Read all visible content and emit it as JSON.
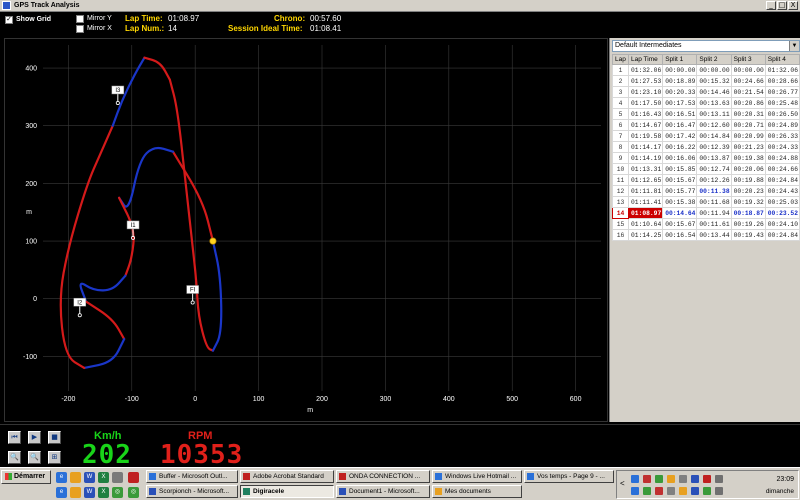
{
  "window": {
    "title": "GPS Track Analysis",
    "minimize": "_",
    "maximize": "□",
    "close": "X"
  },
  "header": {
    "show_grid_label": "Show Grid",
    "show_grid_checked": true,
    "mirror_y_label": "Mirror Y",
    "mirror_x_label": "Mirror X",
    "lap_time_label": "Lap Time:",
    "lap_time_value": "01:08.97",
    "lap_num_label": "Lap Num.:",
    "lap_num_value": "14",
    "chrono_label": "Chrono:",
    "chrono_value": "00:57.60",
    "session_ideal_label": "Session Ideal Time:",
    "session_ideal_value": "01:08.41"
  },
  "chart_data": {
    "type": "line",
    "xlabel": "m",
    "ylabel": "m",
    "xlim": [
      -240,
      640
    ],
    "ylim": [
      -160,
      440
    ],
    "grid": true,
    "x_ticks": [
      "-200",
      "-100",
      "0",
      "100",
      "200",
      "300",
      "400",
      "500",
      "600"
    ],
    "y_ticks": [
      "-100",
      "0",
      "100",
      "200",
      "300",
      "400"
    ],
    "markers": [
      {
        "label": "I3",
        "x": -122,
        "y": 362
      },
      {
        "label": "I1",
        "x": -98,
        "y": 128
      },
      {
        "label": "FI",
        "x": -4,
        "y": 16
      },
      {
        "label": "I2",
        "x": -182,
        "y": -6
      }
    ],
    "current_position": {
      "x": 28,
      "y": 100
    },
    "series": [
      {
        "color": "#d41a1a",
        "segment": 1,
        "points": [
          [
            -40,
            380
          ],
          [
            -28,
            330
          ],
          [
            -15,
            200
          ],
          [
            -5,
            100
          ],
          [
            2,
            30
          ],
          [
            5,
            -30
          ],
          [
            18,
            -85
          ],
          [
            28,
            -90
          ]
        ]
      },
      {
        "color": "#1a36c8",
        "segment": 2,
        "points": [
          [
            28,
            -90
          ],
          [
            42,
            -60
          ],
          [
            40,
            40
          ],
          [
            28,
            100
          ]
        ]
      },
      {
        "color": "#d41a1a",
        "segment": 3,
        "points": [
          [
            28,
            100
          ],
          [
            12,
            170
          ],
          [
            -35,
            255
          ]
        ]
      },
      {
        "color": "#1a36c8",
        "segment": 4,
        "points": [
          [
            -35,
            255
          ],
          [
            -65,
            265
          ],
          [
            -88,
            240
          ],
          [
            -105,
            150
          ],
          [
            -120,
            175
          ]
        ]
      },
      {
        "color": "#d41a1a",
        "segment": 5,
        "points": [
          [
            -120,
            175
          ],
          [
            -95,
            120
          ],
          [
            -100,
            70
          ],
          [
            -110,
            40
          ]
        ]
      },
      {
        "color": "#1a36c8",
        "segment": 6,
        "points": [
          [
            -110,
            40
          ],
          [
            -130,
            15
          ],
          [
            -160,
            14
          ],
          [
            -185,
            32
          ],
          [
            -172,
            -5
          ]
        ]
      },
      {
        "color": "#d41a1a",
        "segment": 7,
        "points": [
          [
            -172,
            -5
          ],
          [
            -130,
            -35
          ],
          [
            -112,
            -70
          ]
        ]
      },
      {
        "color": "#1a36c8",
        "segment": 8,
        "points": [
          [
            -112,
            -70
          ],
          [
            -130,
            -110
          ],
          [
            -175,
            -120
          ]
        ]
      },
      {
        "color": "#d41a1a",
        "segment": 9,
        "points": [
          [
            -175,
            -120
          ],
          [
            -205,
            -100
          ],
          [
            -215,
            0
          ],
          [
            -200,
            90
          ],
          [
            -170,
            200
          ],
          [
            -150,
            250
          ],
          [
            -130,
            300
          ]
        ]
      },
      {
        "color": "#1a36c8",
        "segment": 10,
        "points": [
          [
            -130,
            300
          ],
          [
            -115,
            345
          ],
          [
            -95,
            390
          ],
          [
            -80,
            418
          ]
        ]
      },
      {
        "color": "#d41a1a",
        "segment": 11,
        "points": [
          [
            -80,
            418
          ],
          [
            -55,
            410
          ],
          [
            -40,
            380
          ]
        ]
      }
    ]
  },
  "laps_panel": {
    "dropdown_value": "Default Intermediates",
    "dropdown_arrow": "▼",
    "columns": [
      "Lap",
      "Lap Time",
      "Split 1",
      "Split 2",
      "Split 3",
      "Split 4"
    ],
    "rows": [
      [
        "1",
        "01:32.06",
        "00:00.00",
        "00:00.00",
        "00:00.00",
        "01:32.06"
      ],
      [
        "2",
        "01:27.53",
        "00:18.89",
        "00:15.32",
        "00:24.66",
        "00:28.66"
      ],
      [
        "3",
        "01:23.10",
        "00:20.33",
        "00:14.46",
        "00:21.54",
        "00:26.77"
      ],
      [
        "4",
        "01:17.50",
        "00:17.53",
        "00:13.63",
        "00:20.86",
        "00:25.48"
      ],
      [
        "5",
        "01:16.43",
        "00:16.51",
        "00:13.11",
        "00:20.31",
        "00:26.50"
      ],
      [
        "6",
        "01:14.67",
        "00:16.47",
        "00:12.60",
        "00:20.71",
        "00:24.89"
      ],
      [
        "7",
        "01:19.58",
        "00:17.42",
        "00:14.84",
        "00:20.99",
        "00:26.33"
      ],
      [
        "8",
        "01:14.17",
        "00:16.22",
        "00:12.39",
        "00:21.23",
        "00:24.33"
      ],
      [
        "9",
        "01:14.19",
        "00:16.06",
        "00:13.87",
        "00:19.38",
        "00:24.88"
      ],
      [
        "10",
        "01:13.31",
        "00:15.85",
        "00:12.74",
        "00:20.06",
        "00:24.66"
      ],
      [
        "11",
        "01:12.65",
        "00:15.67",
        "00:12.26",
        "00:19.88",
        "00:24.84"
      ],
      [
        "12",
        "01:11.81",
        "00:15.77",
        "00:11.38",
        "00:20.23",
        "00:24.43"
      ],
      [
        "13",
        "01:11.41",
        "00:15.38",
        "00:11.68",
        "00:19.32",
        "00:25.03"
      ],
      [
        "14",
        "01:08.97",
        "00:14.64",
        "00:11.94",
        "00:18.87",
        "00:23.52"
      ],
      [
        "15",
        "01:10.64",
        "00:15.67",
        "00:11.61",
        "00:19.26",
        "00:24.10"
      ],
      [
        "16",
        "01:14.25",
        "00:16.54",
        "00:13.44",
        "00:19.43",
        "00:24.84"
      ]
    ],
    "best_cells": [
      [
        12,
        3
      ],
      [
        14,
        2
      ],
      [
        14,
        4
      ],
      [
        14,
        5
      ]
    ],
    "selected_lap": "14"
  },
  "dashboard": {
    "speed_label": "Km/h",
    "speed_value": "202",
    "speed_color": "#19d419",
    "rpm_label": "RPM",
    "rpm_value": "10353",
    "rpm_color": "#e0201a",
    "buttons": [
      "⏮",
      "▶",
      "■",
      "🔍",
      "🔍",
      "⊞"
    ]
  },
  "taskbar": {
    "start_label": "Démarrer",
    "tasks_row1": [
      "Buffer - Microsoft Outl...",
      "Adobe Acrobat Standard",
      "ONDA CONNECTION ...",
      "Windows Live Hotmail ...",
      "Vos temps - Page 9 - ..."
    ],
    "tasks_row2": [
      "Scorpionch - Microsoft...",
      "Digiracele",
      "Document1 - Microsoft...",
      "Mes documents"
    ],
    "active_task": "Digiracele",
    "quick_launch": [
      "e",
      "W",
      "X",
      "e",
      "W",
      "X",
      "◎",
      "◎"
    ],
    "tray_nav": "<",
    "clock": "23:09",
    "day": "dimanche"
  }
}
